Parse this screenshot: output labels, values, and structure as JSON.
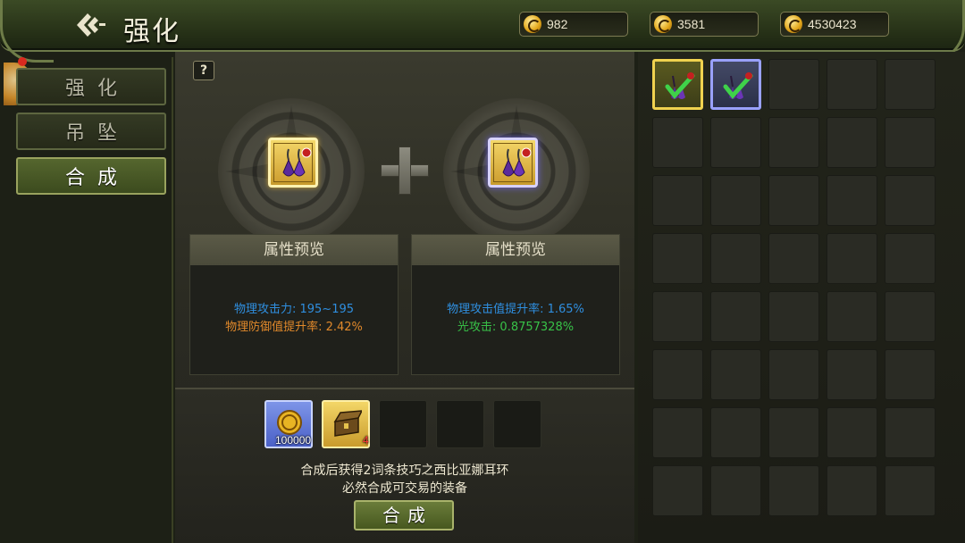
{
  "header": {
    "title": "强化",
    "currencies": [
      {
        "icon": "compass-coin-icon",
        "value": "982"
      },
      {
        "icon": "c-coin-icon",
        "value": "3581"
      },
      {
        "icon": "gold-coin-icon",
        "value": "4530423"
      }
    ]
  },
  "nav": {
    "tabs": [
      {
        "label": "强化",
        "active": false
      },
      {
        "label": "吊坠",
        "active": false
      },
      {
        "label": "合成",
        "active": true
      }
    ]
  },
  "center": {
    "help_label": "?",
    "slots": [
      {
        "icon": "purple-earring-icon",
        "frame": "gold"
      },
      {
        "icon": "purple-earring-icon",
        "frame": "purple"
      }
    ],
    "preview_left": {
      "title": "属性预览",
      "lines": [
        {
          "text": "物理攻击力: 195~195",
          "color": "#2f8fe0"
        },
        {
          "text": "物理防御值提升率: 2.42%",
          "color": "#e1892b"
        }
      ]
    },
    "preview_right": {
      "title": "属性预览",
      "lines": [
        {
          "text": "物理攻击值提升率: 1.65%",
          "color": "#2f8fe0"
        },
        {
          "text": "光攻击: 0.8757328%",
          "color": "#38c248"
        }
      ]
    },
    "materials": [
      {
        "icon": "gold-coin-icon",
        "count": "100000"
      },
      {
        "icon": "treasure-chest-icon",
        "count": "4"
      }
    ],
    "result_line1": "合成后获得2词条技巧之西比亚娜耳环",
    "result_line2": "必然合成可交易的装备",
    "craft_button": "合成"
  },
  "inventory": {
    "items": [
      {
        "icon": "checked-earring-icon",
        "frame": "gold"
      },
      {
        "icon": "checked-earring-icon",
        "frame": "purple"
      }
    ]
  },
  "colors": {
    "accent_green": "#55662e",
    "gold_frame": "#f0d24f",
    "purple_frame": "#9aa1ff",
    "stat_blue": "#2f8fe0",
    "stat_orange": "#e1892b",
    "stat_green": "#38c248"
  }
}
